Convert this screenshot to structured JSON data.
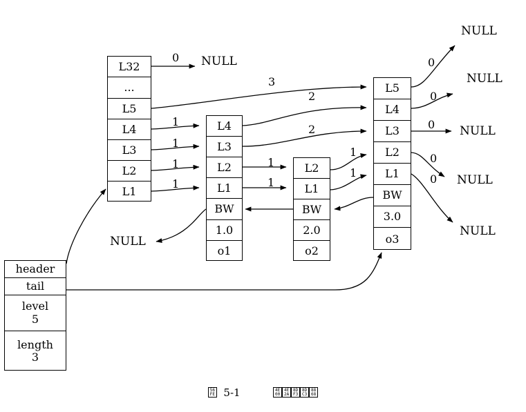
{
  "diagram": {
    "title_caption": {
      "figure_label": "图 5-1",
      "figure_label_codepoints": [
        "56FE"
      ],
      "description_codepoints": [
        "4E00",
        "4E2A",
        "8DF3",
        "8DC3",
        "8868"
      ],
      "description_text": "一个跳跃表"
    },
    "skiplist_struct": {
      "name": "zskiplist",
      "fields": [
        {
          "label": "header",
          "value": ""
        },
        {
          "label": "tail",
          "value": ""
        },
        {
          "label": "level",
          "value": "5"
        },
        {
          "label": "length",
          "value": "3"
        }
      ]
    },
    "header_node": {
      "name": "header-node",
      "levels": [
        "L32",
        "...",
        "L5",
        "L4",
        "L3",
        "L2",
        "L1"
      ]
    },
    "nodes": [
      {
        "name": "node-o1",
        "levels": [
          "L4",
          "L3",
          "L2",
          "L1"
        ],
        "backward_label": "BW",
        "score": "1.0",
        "object": "o1"
      },
      {
        "name": "node-o2",
        "levels": [
          "L2",
          "L1"
        ],
        "backward_label": "BW",
        "score": "2.0",
        "object": "o2"
      },
      {
        "name": "node-o3",
        "levels": [
          "L5",
          "L4",
          "L3",
          "L2",
          "L1"
        ],
        "backward_label": "BW",
        "score": "3.0",
        "object": "o3"
      }
    ],
    "null_labels": [
      {
        "id": "null-top-l32",
        "text": "NULL"
      },
      {
        "id": "null-right-1",
        "text": "NULL"
      },
      {
        "id": "null-right-2",
        "text": "NULL"
      },
      {
        "id": "null-right-3",
        "text": "NULL"
      },
      {
        "id": "null-right-4",
        "text": "NULL"
      },
      {
        "id": "null-right-5",
        "text": "NULL"
      },
      {
        "id": "null-backward-o1",
        "text": "NULL"
      }
    ],
    "span_labels": [
      {
        "id": "span-header-l32",
        "text": "0"
      },
      {
        "id": "span-header-l5",
        "text": "3"
      },
      {
        "id": "span-header-l4",
        "text": "1"
      },
      {
        "id": "span-header-l3",
        "text": "1"
      },
      {
        "id": "span-header-l2",
        "text": "1"
      },
      {
        "id": "span-header-l1",
        "text": "1"
      },
      {
        "id": "span-o1-l4",
        "text": "2"
      },
      {
        "id": "span-o1-l3",
        "text": "2"
      },
      {
        "id": "span-o1-l2",
        "text": "1"
      },
      {
        "id": "span-o1-l1",
        "text": "1"
      },
      {
        "id": "span-o2-l2",
        "text": "1"
      },
      {
        "id": "span-o2-l1",
        "text": "1"
      },
      {
        "id": "span-o3-l5",
        "text": "0"
      },
      {
        "id": "span-o3-l4",
        "text": "0"
      },
      {
        "id": "span-o3-l3",
        "text": "0"
      },
      {
        "id": "span-o3-l2",
        "text": "0"
      },
      {
        "id": "span-o3-l1",
        "text": "0"
      }
    ],
    "colors": {
      "stroke": "#000000",
      "background": "#ffffff",
      "text": "#000000"
    }
  }
}
